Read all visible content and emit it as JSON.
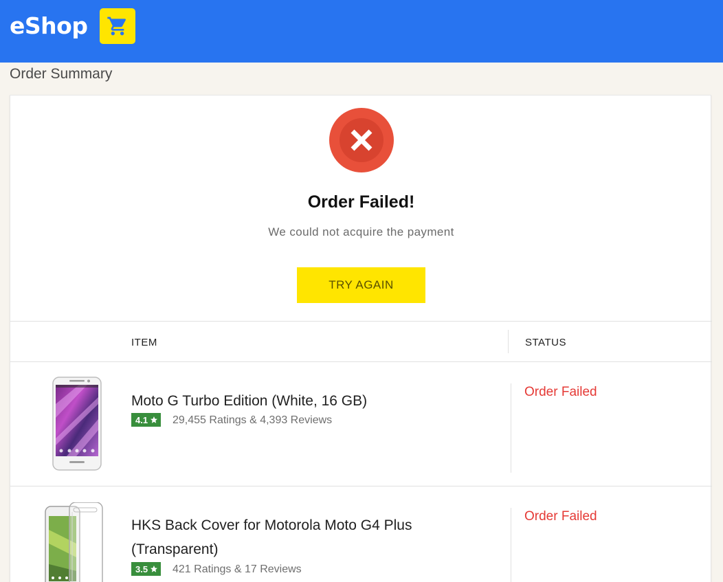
{
  "header": {
    "logo_text": "eShop",
    "brand_color": "#2874f0",
    "accent_color": "#ffe500",
    "cart_icon": "cart-icon"
  },
  "page": {
    "title": "Order Summary"
  },
  "result": {
    "icon": "close-icon",
    "title": "Order Failed!",
    "message": "We could not acquire the payment",
    "button_label": "TRY AGAIN",
    "error_color": "#e8503a"
  },
  "table": {
    "headers": {
      "item": "ITEM",
      "status": "STATUS"
    },
    "rows": [
      {
        "title": "Moto G Turbo Edition (White, 16 GB)",
        "rating": "4.1",
        "reviews": "29,455 Ratings & 4,393 Reviews",
        "status": "Order Failed"
      },
      {
        "title": "HKS Back Cover for Motorola Moto G4 Plus (Transparent)",
        "rating": "3.5",
        "reviews": "421 Ratings & 17 Reviews",
        "status": "Order Failed"
      }
    ]
  },
  "colors": {
    "rating_badge": "#388e3c",
    "status_failed": "#e53935"
  }
}
